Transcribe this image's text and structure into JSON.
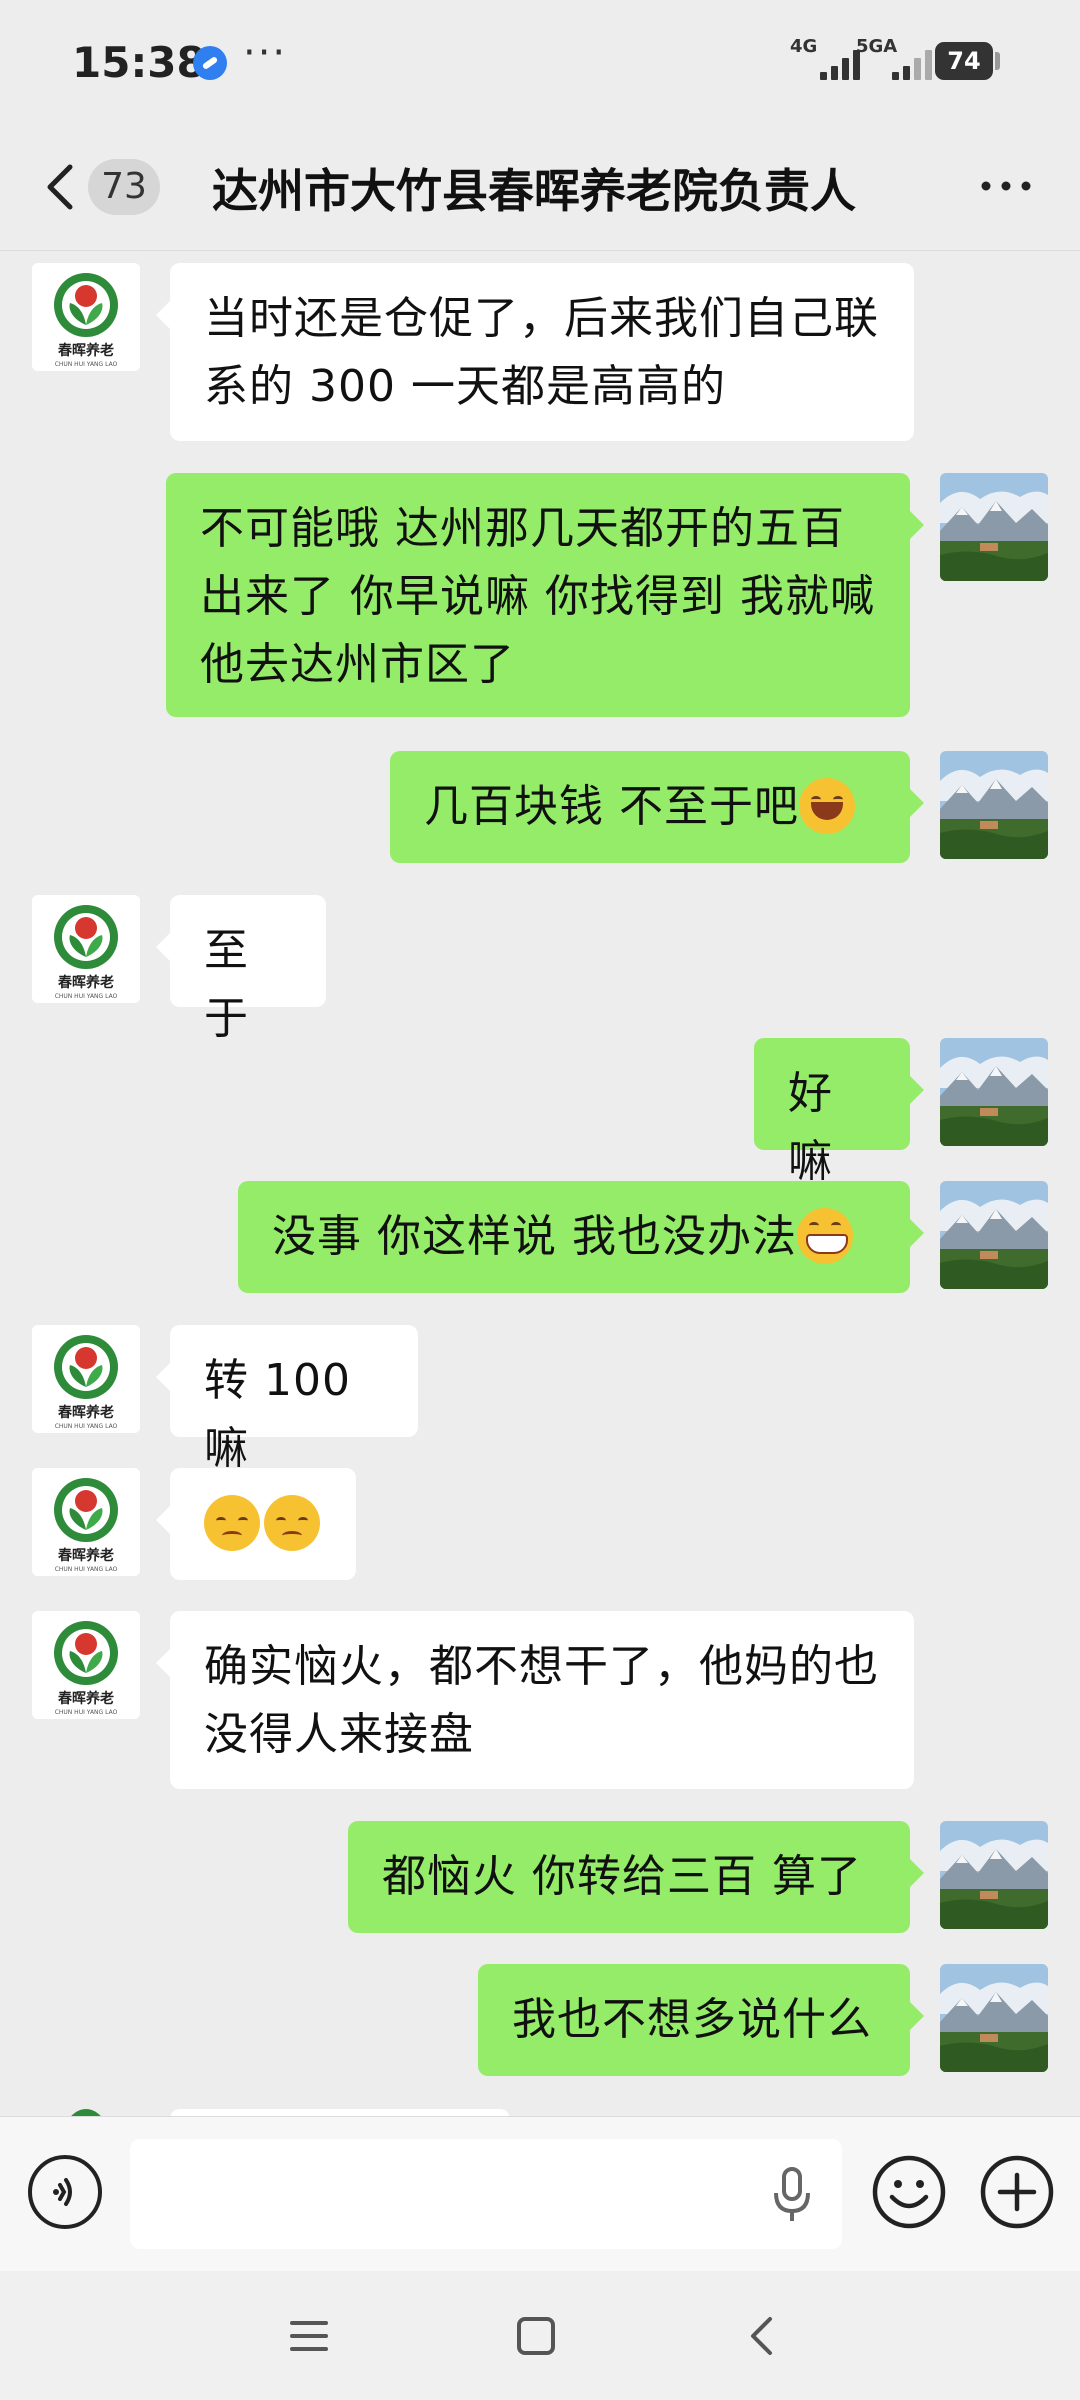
{
  "status_bar": {
    "time": "15:38",
    "more": "···",
    "net1": "4G",
    "net2": "5GA",
    "battery": "74"
  },
  "header": {
    "unread_count": "73",
    "title": "达州市大竹县春晖养老院负责人"
  },
  "messages": [
    {
      "side": "left",
      "text": "当时还是仓促了，后来我们自己联系的 300 一天都是高高的"
    },
    {
      "side": "right",
      "text": "不可能哦  达州那几天都开的五百出来了  你早说嘛 你找得到  我就喊他去达州市区了"
    },
    {
      "side": "right",
      "text": "几百块钱  不至于吧",
      "emoji": "laugh-cry-emoji"
    },
    {
      "side": "left",
      "text": "至于"
    },
    {
      "side": "right",
      "text": "好嘛"
    },
    {
      "side": "right",
      "text": "没事  你这样说 我也没办法",
      "emoji": "grin-emoji"
    },
    {
      "side": "left",
      "text": "转 100 嘛"
    },
    {
      "side": "left",
      "text": "",
      "emoji": "pensive-emoji x2"
    },
    {
      "side": "left",
      "text": "确实恼火，都不想干了，他妈的也没得人来接盘"
    },
    {
      "side": "right",
      "text": "都恼火  你转给三百 算了"
    },
    {
      "side": "right",
      "text": "我也不想多说什么"
    }
  ],
  "contact_avatar": {
    "logo_text": "春晖养老",
    "logo_subtext": "CHUN HUI YANG LAO"
  },
  "input_bar": {
    "placeholder": ""
  },
  "colors": {
    "background": "#ededed",
    "sent_bubble": "#95ec69",
    "received_bubble": "#ffffff",
    "logo_green": "#2e8b3a",
    "logo_red": "#d6382f"
  },
  "icons": [
    "back-icon",
    "more-icon",
    "voice-icon",
    "mic-icon",
    "emoji-icon",
    "plus-icon",
    "menu-icon",
    "home-icon",
    "nav-back-icon"
  ]
}
